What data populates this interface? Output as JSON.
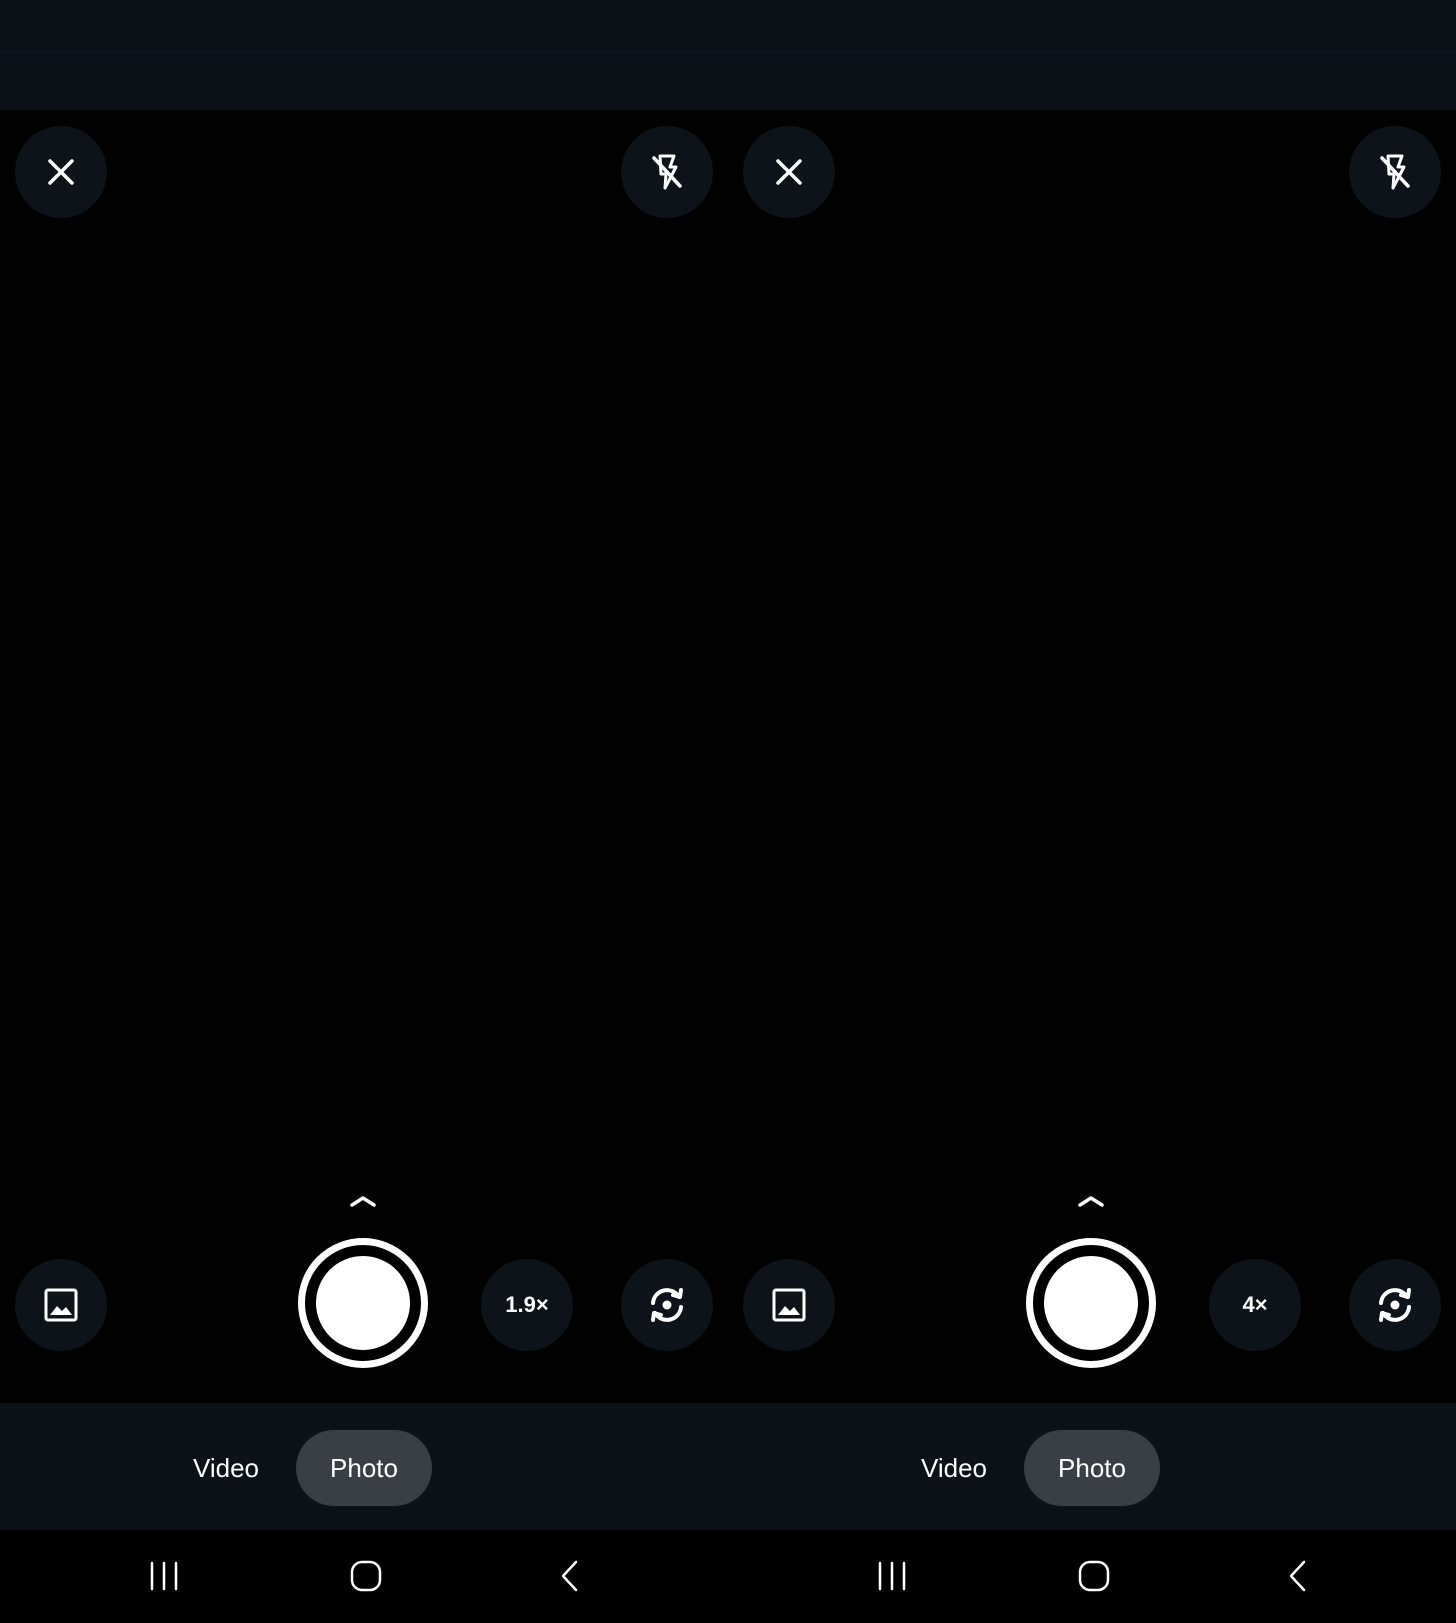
{
  "colors": {
    "top_strip": "#0b1117",
    "viewfinder": "#020202",
    "button_bg": "#0d1318",
    "mode_bar": "#0c1218",
    "mode_selected": "#3a3f45",
    "icon": "#ffffff"
  },
  "screens": [
    {
      "top_bar": {
        "close_icon": "close-icon",
        "flash_icon": "flash-off-icon"
      },
      "controls": {
        "gallery_icon": "image-icon",
        "zoom_label": "1.9×",
        "flip_icon": "camera-flip-icon",
        "chevron_icon": "chevron-up-icon"
      },
      "modes": [
        {
          "label": "Video",
          "selected": false
        },
        {
          "label": "Photo",
          "selected": true
        }
      ],
      "nav": {
        "recents_icon": "recents-icon",
        "home_icon": "home-icon",
        "back_icon": "back-icon"
      }
    },
    {
      "top_bar": {
        "close_icon": "close-icon",
        "flash_icon": "flash-off-icon"
      },
      "controls": {
        "gallery_icon": "image-icon",
        "zoom_label": "4×",
        "flip_icon": "camera-flip-icon",
        "chevron_icon": "chevron-up-icon"
      },
      "modes": [
        {
          "label": "Video",
          "selected": false
        },
        {
          "label": "Photo",
          "selected": true
        }
      ],
      "nav": {
        "recents_icon": "recents-icon",
        "home_icon": "home-icon",
        "back_icon": "back-icon"
      }
    }
  ]
}
